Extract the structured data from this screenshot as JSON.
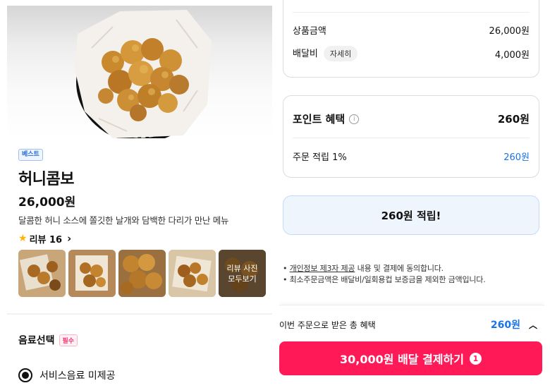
{
  "product": {
    "badge": "베스트",
    "name": "허니콤보",
    "price": "26,000원",
    "description": "달콤한 허니 소스에 쫄깃한 날개와 담백한 다리가 만난 메뉴",
    "review_star_icon": "star-icon",
    "review_label": "리뷰 16",
    "review_more_label_line1": "리뷰 사진",
    "review_more_label_line2": "모두보기"
  },
  "options": {
    "drink_title": "음료선택",
    "required_label": "필수",
    "choice_label": "서비스음료 미제공"
  },
  "summary": {
    "subtotal_label": "상품금액",
    "subtotal_value": "26,000원",
    "delivery_label": "배달비",
    "delivery_detail": "자세히",
    "delivery_value": "4,000원"
  },
  "points": {
    "title": "포인트 혜택",
    "total": "260원",
    "earn_label": "주문 적립 1%",
    "earn_value": "260원",
    "banner": "260원 적립!"
  },
  "notices": {
    "line1_link": "개인정보 제3자 제공",
    "line1_rest": " 내용 및 결제에 동의합니다.",
    "line2": "최소주문금액은 배달비/일회용컵 보증금을 제외한 금액입니다."
  },
  "bottom": {
    "benefit_label": "이번 주문으로 받은 총 혜택",
    "benefit_value": "260원",
    "pay_label": "30,000원 배달 결제하기",
    "pay_count": "1"
  },
  "colors": {
    "accent": "#ff1a57",
    "link_blue": "#1a73e8",
    "banner_bg": "#eef5fd"
  }
}
